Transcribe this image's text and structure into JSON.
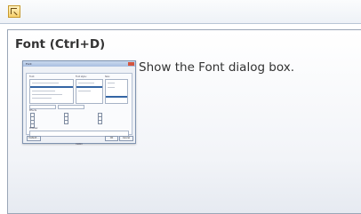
{
  "ribbon": {
    "launcher_icon": "dialog-launcher-icon"
  },
  "tooltip": {
    "title": "Font (Ctrl+D)",
    "description": "Show the Font dialog box."
  },
  "dialog_preview": {
    "title": "Font",
    "tabs": [
      "Font",
      "Character Spacing"
    ],
    "labels": {
      "font": "Font:",
      "style": "Font style:",
      "size": "Size:",
      "effects": "Effects",
      "preview": "Preview",
      "sample": "Calibri"
    },
    "buttons": [
      "Default...",
      "OK",
      "Cancel"
    ]
  }
}
